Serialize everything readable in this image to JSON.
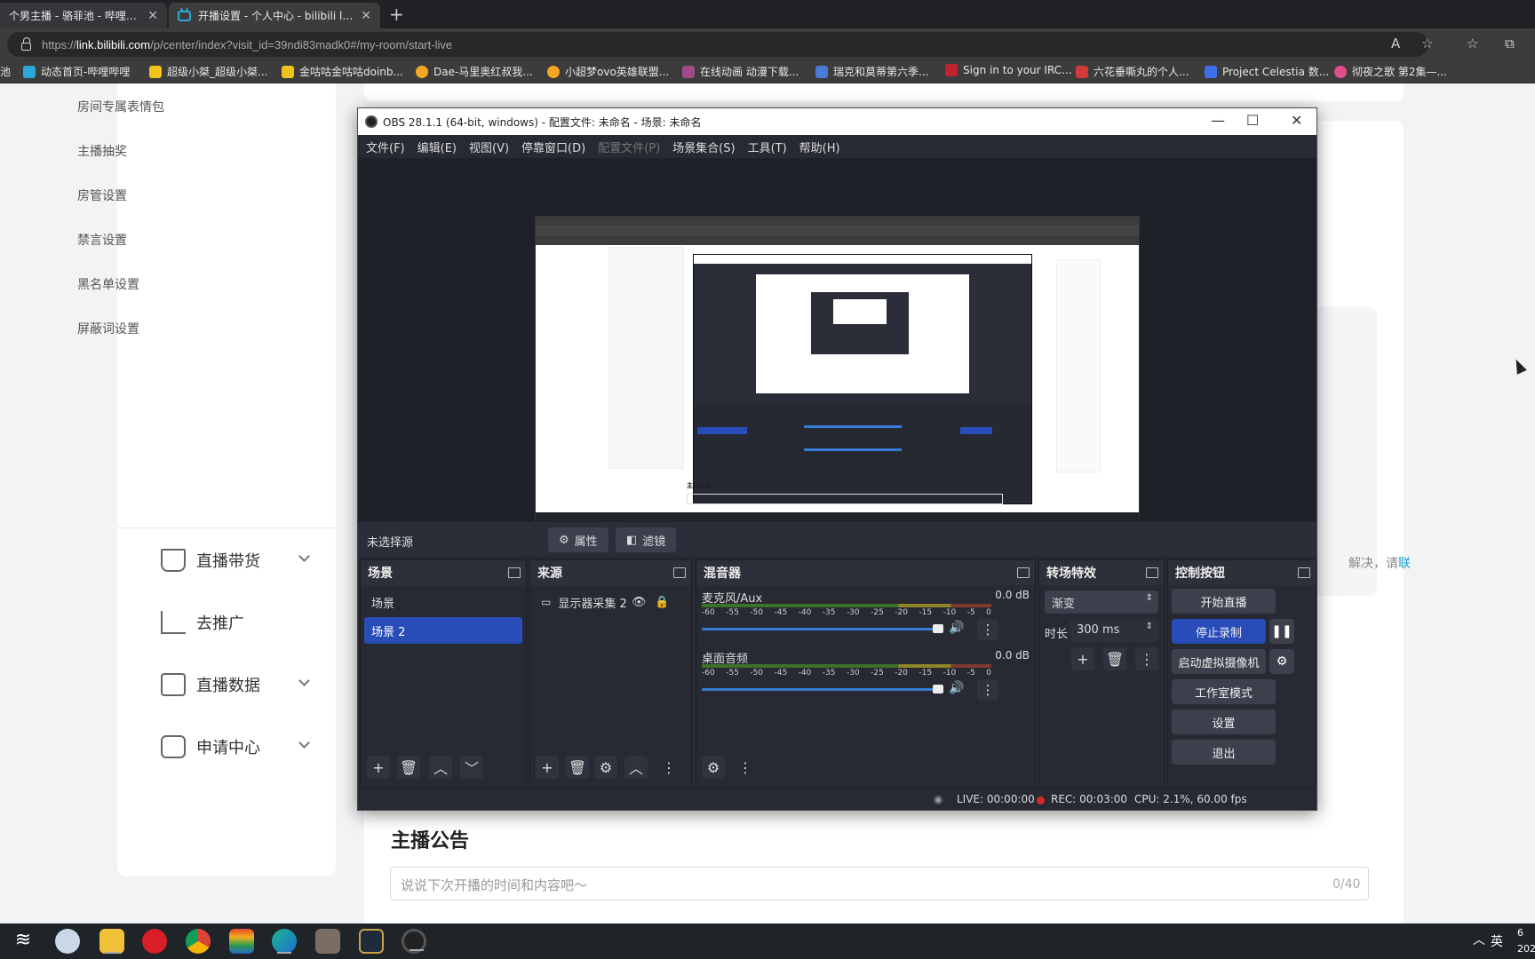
{
  "browser": {
    "tabs": [
      {
        "title": "个男主播 - 骆菲池 - 哔哩哔哩直",
        "active": false
      },
      {
        "title": "开播设置 - 个人中心 - bilibili link",
        "active": true
      }
    ],
    "url_prefix": "https://",
    "url_host": "link.bilibili.com",
    "url_path": "/p/center/index?visit_id=39ndi83madk0#/my-room/start-live",
    "bookmarks": [
      {
        "label": "池",
        "icon_color": "#3f3f3f"
      },
      {
        "label": "动态首页-哔哩哔哩",
        "icon_color": "#2ba7d8"
      },
      {
        "label": "超级小桀_超级小桀...",
        "icon_color": "#f0c419"
      },
      {
        "label": "金咕咕金咕咕doinb...",
        "icon_color": "#f0c419"
      },
      {
        "label": "Dae-马里奥红叔我...",
        "icon_color": "#f5a623"
      },
      {
        "label": "小超梦ovo英雄联盟...",
        "icon_color": "#f5a623"
      },
      {
        "label": "在线动画 动漫下载...",
        "icon_color": "#a04a8a"
      },
      {
        "label": "瑞克和莫蒂第六季...",
        "icon_color": "#4a7bd5"
      },
      {
        "label": "Sign in to your IRC...",
        "icon_color": "#c0232b"
      },
      {
        "label": "六花垂嘶丸的个人...",
        "icon_color": "#d33a3a"
      },
      {
        "label": "Project Celestia 数...",
        "icon_color": "#3f6ee8"
      },
      {
        "label": "彻夜之歌 第2集—...",
        "icon_color": "#e14e8a"
      }
    ]
  },
  "page": {
    "side_links": [
      "房间专属表情包",
      "主播抽奖",
      "房管设置",
      "禁言设置",
      "黑名单设置",
      "屏蔽词设置"
    ],
    "side_groups": [
      {
        "label": "直播带货",
        "icon": "cart-icon",
        "expandable": true
      },
      {
        "label": "去推广",
        "icon": "chart-bars-icon",
        "expandable": false
      },
      {
        "label": "直播数据",
        "icon": "data-screen-icon",
        "expandable": true
      },
      {
        "label": "申请中心",
        "icon": "apply-form-icon",
        "expandable": true
      }
    ],
    "tip_text": "解决，请",
    "tip_link": "联",
    "announcement": {
      "title": "主播公告",
      "placeholder": "说说下次开播的时间和内容吧～",
      "count": "0/40"
    }
  },
  "obs": {
    "title": "OBS 28.1.1 (64-bit, windows) - 配置文件: 未命名 - 场景: 未命名",
    "menu": [
      {
        "label": "文件(F)",
        "disabled": false
      },
      {
        "label": "编辑(E)",
        "disabled": false
      },
      {
        "label": "视图(V)",
        "disabled": false
      },
      {
        "label": "停靠窗口(D)",
        "disabled": false
      },
      {
        "label": "配置文件(P)",
        "disabled": true
      },
      {
        "label": "场景集合(S)",
        "disabled": false
      },
      {
        "label": "工具(T)",
        "disabled": false
      },
      {
        "label": "帮助(H)",
        "disabled": false
      }
    ],
    "no_source": "未选择源",
    "properties_label": "属性",
    "filters_label": "滤镜",
    "docks": {
      "scenes": {
        "title": "场景",
        "items": [
          "场景",
          "场景 2"
        ],
        "selected": 1
      },
      "sources": {
        "title": "来源",
        "items": [
          "显示器采集 2"
        ]
      },
      "mixer": {
        "title": "混音器",
        "channels": [
          {
            "name": "麦克风/Aux",
            "db": "0.0 dB"
          },
          {
            "name": "桌面音频",
            "db": "0.0 dB"
          }
        ],
        "ticks": [
          "-60",
          "-55",
          "-50",
          "-45",
          "-40",
          "-35",
          "-30",
          "-25",
          "-20",
          "-15",
          "-10",
          "-5",
          "0"
        ]
      },
      "transitions": {
        "title": "转场特效",
        "type": "渐变",
        "duration_label": "时长",
        "duration": "300 ms"
      },
      "controls": {
        "title": "控制按钮",
        "start_stream": "开始直播",
        "stop_record": "停止录制",
        "virtual_cam": "启动虚拟摄像机",
        "studio_mode": "工作室模式",
        "settings": "设置",
        "exit": "退出"
      }
    },
    "status": {
      "live": "LIVE: 00:00:00",
      "rec": "REC: 00:03:00",
      "cpu": "CPU: 2.1%, 60.00 fps"
    },
    "preview": {
      "nested_heading": "主播公告"
    }
  },
  "taskbar": {
    "ime": "英",
    "clock_top": "6",
    "clock_bottom": "202"
  }
}
